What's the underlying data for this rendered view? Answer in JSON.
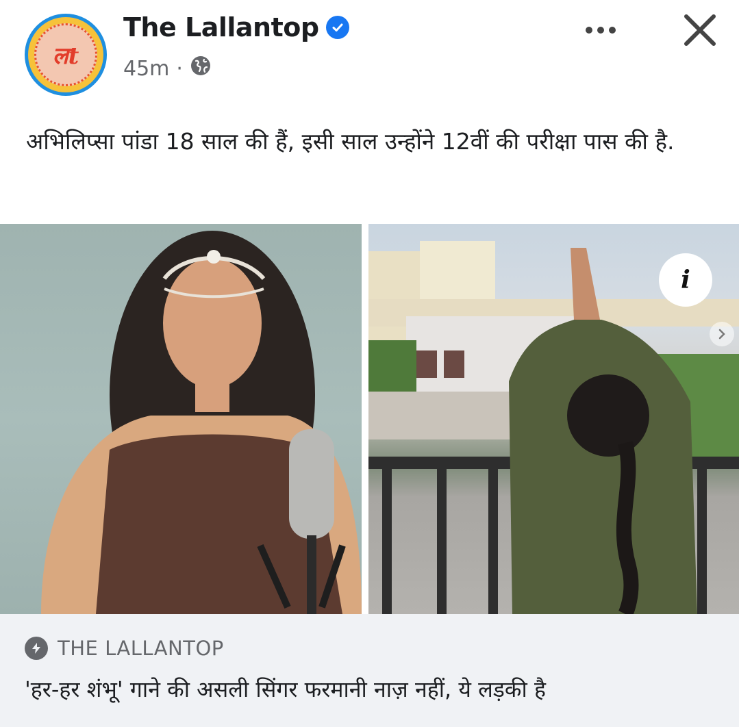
{
  "post": {
    "page_name": "The Lallantop",
    "avatar_text": "लt",
    "verified_icon": "verified-badge-icon",
    "time": "45m",
    "separator": "·",
    "privacy_icon": "globe-icon",
    "more_icon": "more-options-icon",
    "close_icon": "close-icon",
    "caption": "अभिलिप्सा पांडा 18 साल की हैं, इसी साल उन्होंने 12वीं की परीक्षा पास की है."
  },
  "media": {
    "info_label": "i",
    "next_icon": "chevron-right-icon"
  },
  "link_preview": {
    "source_icon": "bolt-icon",
    "source": "THE LALLANTOP",
    "headline": "'हर-हर शंभू' गाने की असली सिंगर फरमानी नाज़ नहीं, ये लड़की है"
  },
  "colors": {
    "brand_blue": "#1877f2",
    "text_primary": "#1c1e21",
    "text_secondary": "#65676b",
    "link_bg": "#f0f2f5"
  }
}
